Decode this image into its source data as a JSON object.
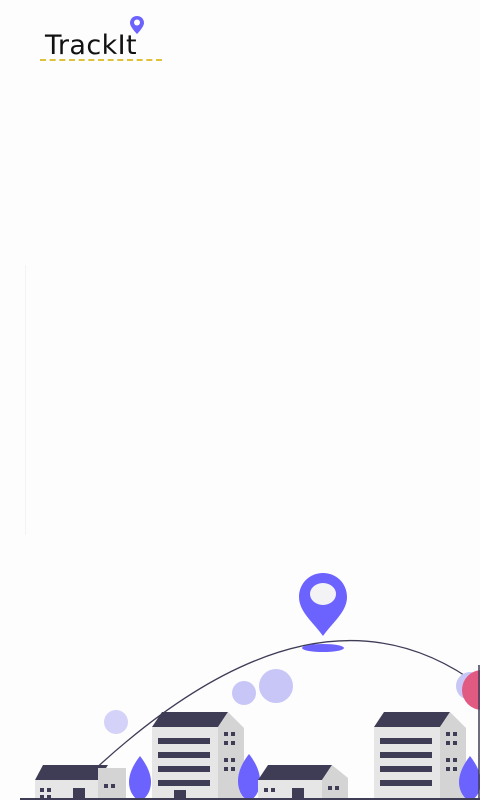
{
  "app": {
    "logo_text": "TrackIt",
    "logo_icon": "location-pin-icon"
  },
  "illustration": {
    "subject": "city-skyline-with-location-pin",
    "accent_color": "#6c63ff",
    "building_roof_color": "#3f3d56",
    "building_body_color": "#e6e6e6"
  }
}
